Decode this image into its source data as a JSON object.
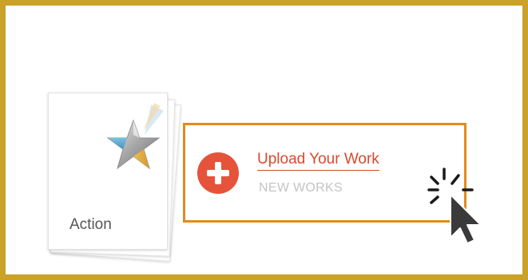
{
  "card": {
    "label": "Action",
    "icon": "star-logo-icon"
  },
  "upload": {
    "title": "Upload Your Work",
    "subtitle": "NEW WORKS",
    "icon": "plus-circle-icon",
    "accent": "#e38a1a",
    "button_color": "#e5533a"
  },
  "frame": {
    "border_color": "#c9a227"
  },
  "cursor": {
    "icon": "click-cursor-icon"
  }
}
